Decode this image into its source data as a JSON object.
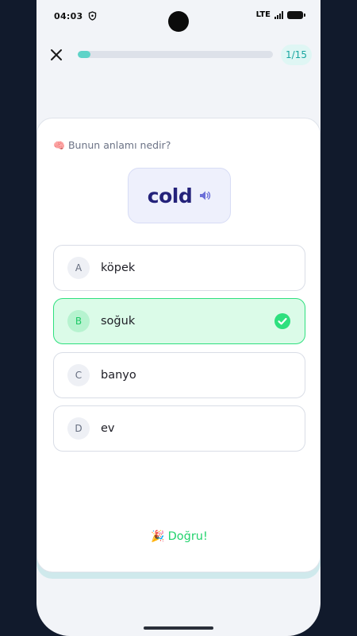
{
  "status_bar": {
    "time": "04:03",
    "network": "LTE"
  },
  "topbar": {
    "progress_fraction": 0.0667,
    "counter": "1/15"
  },
  "quiz": {
    "question": "Bunun anlamı nedir?",
    "question_icon": "🧠",
    "word": "cold",
    "options": [
      {
        "letter": "A",
        "text": "köpek",
        "state": "default"
      },
      {
        "letter": "B",
        "text": "soğuk",
        "state": "correct"
      },
      {
        "letter": "C",
        "text": "banyo",
        "state": "default"
      },
      {
        "letter": "D",
        "text": "ev",
        "state": "default"
      }
    ],
    "feedback_icon": "🎉",
    "feedback": "Doğru!"
  },
  "colors": {
    "accent_teal": "#5fd3c8",
    "correct_green": "#2ee07e",
    "word_color": "#24227a",
    "background": "#111a2c"
  }
}
